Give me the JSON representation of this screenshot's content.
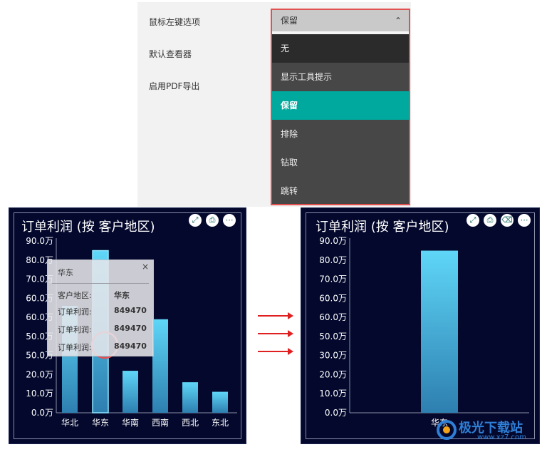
{
  "settings": {
    "labels": [
      "鼠标左键选项",
      "默认查看器",
      "启用PDF导出"
    ],
    "dropdown": {
      "selected": "保留",
      "options": [
        "无",
        "显示工具提示",
        "保留",
        "排除",
        "钻取",
        "跳转"
      ],
      "active_index": 2
    }
  },
  "left_chart": {
    "title": "订单利润 (按 客户地区)",
    "tooltip": {
      "title": "华东",
      "rows": [
        {
          "label": "客户地区:",
          "value": "华东"
        },
        {
          "label": "订单利润:",
          "value": "849470"
        },
        {
          "label": "订单利润:",
          "value": "849470"
        },
        {
          "label": "订单利润:",
          "value": "849470"
        }
      ]
    }
  },
  "right_chart": {
    "title": "订单利润 (按 客户地区)"
  },
  "chart_data": [
    {
      "type": "bar",
      "title": "订单利润 (按 客户地区)",
      "categories": [
        "华北",
        "华东",
        "华南",
        "西南",
        "西北",
        "东北"
      ],
      "values": [
        560000,
        849470,
        220000,
        490000,
        160000,
        110000
      ],
      "y_ticks": [
        "0.0万",
        "10.0万",
        "20.0万",
        "50.0万",
        "50.0万",
        "60.0万",
        "60.0万",
        "70.0万",
        "80.0万",
        "90.0万"
      ],
      "ylim": [
        0,
        900000
      ],
      "highlight": "华东",
      "bar_color": "#4fc3e8"
    },
    {
      "type": "bar",
      "title": "订单利润 (按 客户地区)",
      "categories": [
        "华东"
      ],
      "values": [
        849470
      ],
      "y_ticks": [
        "0.0万",
        "10.0万",
        "20.0万",
        "30.0万",
        "50.0万",
        "60.0万",
        "60.0万",
        "70.0万",
        "80.0万",
        "90.0万"
      ],
      "ylim": [
        0,
        900000
      ],
      "bar_color": "#4fc3e8"
    }
  ],
  "watermark": {
    "text": "极光下载站",
    "url": "www.xz7.com"
  },
  "colors": {
    "panel_bg": "#03082c",
    "accent": "#00a99d",
    "highlight_border": "#e25050"
  }
}
